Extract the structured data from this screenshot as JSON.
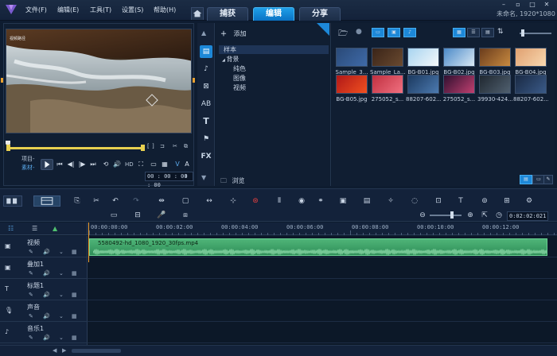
{
  "menu": [
    "文件(F)",
    "编辑(E)",
    "工具(T)",
    "设置(S)",
    "帮助(H)"
  ],
  "main_tabs": [
    "捕获",
    "编辑",
    "分享"
  ],
  "active_tab": "编辑",
  "project_name": "未命名, 1920*1080",
  "player": {
    "video_label": "视频路径",
    "mode_project": "项目-",
    "mode_clip": "素材-",
    "timecode": "00 : 00 : 00 : 00",
    "hd_label": "HD"
  },
  "library": {
    "add_label": "添加",
    "tree": [
      {
        "label": "样本",
        "selected": true,
        "indent": 0
      },
      {
        "label": "背景",
        "selected": false,
        "indent": 0,
        "expand": "▸"
      },
      {
        "label": "纯色",
        "selected": false,
        "indent": 1
      },
      {
        "label": "图像",
        "selected": false,
        "indent": 1
      },
      {
        "label": "视频",
        "selected": false,
        "indent": 1
      }
    ],
    "browse_label": "浏览",
    "strip_icons": [
      "media",
      "instant-project",
      "transition",
      "title-fx",
      "text",
      "graphics",
      "fx"
    ]
  },
  "thumbnails": [
    {
      "caption": "Sample_3...",
      "colors": [
        "#2a4a78",
        "#3f6aa8"
      ]
    },
    {
      "caption": "Sample_La...",
      "colors": [
        "#3a2418",
        "#6a4a30"
      ]
    },
    {
      "caption": "BG-B01.jpg",
      "colors": [
        "#a8d4f0",
        "#f4f8fa"
      ]
    },
    {
      "caption": "BG-B02.jpg",
      "colors": [
        "#4c8ac8",
        "#d8e8f4"
      ]
    },
    {
      "caption": "BG-B03.jpg",
      "colors": [
        "#6a3c1c",
        "#c88a40"
      ]
    },
    {
      "caption": "BG-B04.jpg",
      "colors": [
        "#e0a070",
        "#f8d8b0"
      ]
    },
    {
      "caption": "BG-B05.jpg",
      "colors": [
        "#b01818",
        "#f05020"
      ]
    },
    {
      "caption": "275052_s...",
      "colors": [
        "#c03040",
        "#f07080"
      ]
    },
    {
      "caption": "88207-602...",
      "colors": [
        "#1c3a60",
        "#4c7ab0"
      ]
    },
    {
      "caption": "275052_s...",
      "colors": [
        "#301030",
        "#c04070"
      ]
    },
    {
      "caption": "39930-424...",
      "colors": [
        "#202830",
        "#506070"
      ]
    },
    {
      "caption": "88207-602...",
      "colors": [
        "#1a2a44",
        "#3a5a88"
      ]
    }
  ],
  "timeline": {
    "duration": "0:02:02:021",
    "ruler": [
      "00:00:00:00",
      "00:00:02:00",
      "00:00:04:00",
      "00:00:06:00",
      "00:00:08:00",
      "00:00:10:00",
      "00:00:12:00"
    ],
    "tracks": [
      {
        "name": "视频",
        "icon": "video-track-icon",
        "glyph": "▣"
      },
      {
        "name": "叠加1",
        "icon": "overlay-track-icon",
        "glyph": "▣"
      },
      {
        "name": "标题1",
        "icon": "title-track-icon",
        "glyph": "T"
      },
      {
        "name": "声音",
        "icon": "voice-track-icon",
        "glyph": "🎙"
      },
      {
        "name": "音乐1",
        "icon": "music-track-icon",
        "glyph": "♪"
      }
    ],
    "clip": {
      "name": "5580492-hd_1080_1920_30fps.mp4",
      "color": "#3da068"
    }
  },
  "colors": {
    "accent": "#1d88d8",
    "clip": "#3da068",
    "playhead": "#f0a030",
    "scrub": "#e8d050"
  }
}
